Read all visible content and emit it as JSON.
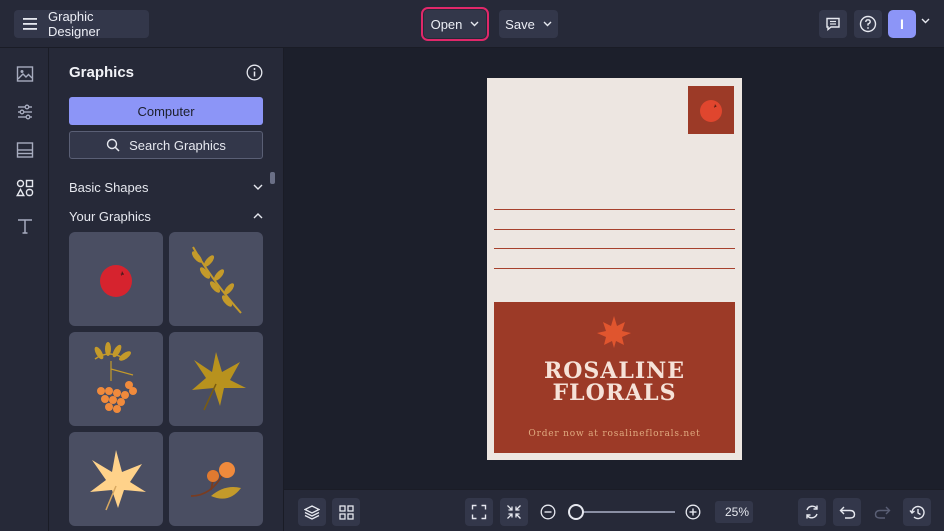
{
  "header": {
    "app_title": "Graphic Designer",
    "open_label": "Open",
    "save_label": "Save",
    "avatar_initial": "I",
    "menu_icon": "hamburger-menu-icon",
    "comments_icon": "comment-icon",
    "help_icon": "help-icon"
  },
  "rail": {
    "items": [
      {
        "icon": "image-icon"
      },
      {
        "icon": "sliders-icon"
      },
      {
        "icon": "layout-icon"
      },
      {
        "icon": "shapes-icon",
        "active": true
      },
      {
        "icon": "text-icon"
      }
    ]
  },
  "panel": {
    "title": "Graphics",
    "computer_label": "Computer",
    "search_label": "Search Graphics",
    "sections": [
      {
        "label": "Basic Shapes",
        "expanded": false
      },
      {
        "label": "Your Graphics",
        "expanded": true
      }
    ],
    "tiles": [
      {
        "name": "red-berry"
      },
      {
        "name": "golden-branch"
      },
      {
        "name": "rowan-berries"
      },
      {
        "name": "mustard-leaf"
      },
      {
        "name": "cream-leaf"
      },
      {
        "name": "orange-berries-sprig"
      }
    ]
  },
  "postcard": {
    "brand_line1": "ROSALINE",
    "brand_line2": "FLORALS",
    "tagline": "Order now at rosalineflorals.net"
  },
  "toolbar": {
    "zoom_value": "25%",
    "zoom_fraction": 0.0
  },
  "colors": {
    "accent": "#8c95f7",
    "highlight": "#e0286a",
    "rust": "#9c3a27",
    "cream": "#ede6e1"
  }
}
